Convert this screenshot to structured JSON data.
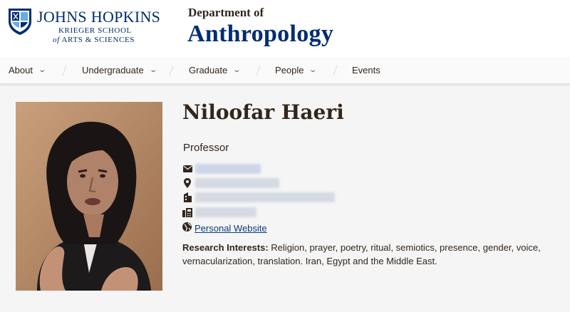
{
  "header": {
    "logo_line1": "JOHNS HOPKINS",
    "logo_line2": "KRIEGER SCHOOL",
    "logo_line3_italic": "of",
    "logo_line3": "ARTS & SCIENCES",
    "dept_prefix": "Department of",
    "dept_name": "Anthropology",
    "brand_color": "#002d72"
  },
  "nav": {
    "items": [
      {
        "label": "About",
        "has_dropdown": true
      },
      {
        "label": "Undergraduate",
        "has_dropdown": true
      },
      {
        "label": "Graduate",
        "has_dropdown": true
      },
      {
        "label": "People",
        "has_dropdown": true
      },
      {
        "label": "Events",
        "has_dropdown": false
      }
    ],
    "chevron": "⌄"
  },
  "profile": {
    "name": "Niloofar Haeri",
    "title": "Professor",
    "contact_icons": [
      "envelope-icon",
      "map-pin-icon",
      "building-icon",
      "fax-icon"
    ],
    "website_icon": "globe-icon",
    "website_label": "Personal Website",
    "research_label": "Research Interests:",
    "research_text": "Religion, prayer, poetry, ritual, semiotics, presence, gender, voice, vernacularization, translation. Iran, Egypt and the Middle East."
  }
}
